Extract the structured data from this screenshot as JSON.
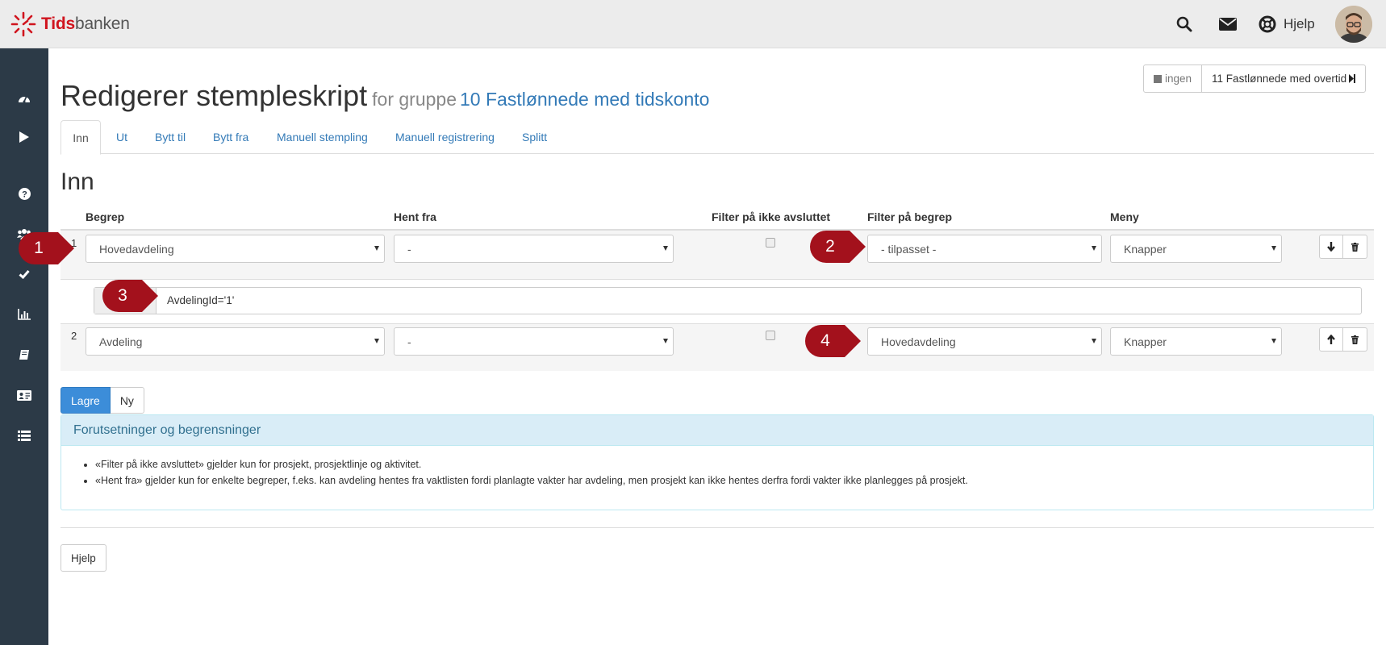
{
  "app": {
    "logo_bold": "Tids",
    "logo_rest": "banken",
    "help_label": "Hjelp"
  },
  "sidebar": {
    "icons": [
      "dashboard-icon",
      "play-icon",
      "question-icon",
      "users-icon",
      "check-icon",
      "bar-chart-icon",
      "book-icon",
      "id-card-icon",
      "list-icon"
    ]
  },
  "group_switch": {
    "prev_label": "ingen",
    "next_label": "11 Fastlønnede med overtid"
  },
  "page": {
    "title": "Redigerer stempleskript",
    "for_text": "for gruppe",
    "group_name": "10 Fastlønnede med tidskonto"
  },
  "tabs": [
    "Inn",
    "Ut",
    "Bytt til",
    "Bytt fra",
    "Manuell stempling",
    "Manuell registrering",
    "Splitt"
  ],
  "active_tab": "Inn",
  "section_title": "Inn",
  "table": {
    "headers": [
      "Begrep",
      "Hent fra",
      "Filter på ikke avsluttet",
      "Filter på begrep",
      "Meny"
    ],
    "rows": [
      {
        "num": "1",
        "begrep": "Hovedavdeling",
        "hent_fra": "-",
        "filter_ikke_avsluttet": false,
        "filter_begrep": "- tilpasset -",
        "meny": "Knapper"
      },
      {
        "num": "2",
        "begrep": "Avdeling",
        "hent_fra": "-",
        "filter_ikke_avsluttet": false,
        "filter_begrep": "Hovedavdeling",
        "meny": "Knapper"
      }
    ],
    "custom_filter_value": "AvdelingId='1'"
  },
  "buttons": {
    "save": "Lagre",
    "new": "Ny",
    "help": "Hjelp"
  },
  "panel": {
    "title": "Forutsetninger og begrensninger",
    "items": [
      "«Filter på ikke avsluttet» gjelder kun for prosjekt, prosjektlinje og aktivitet.",
      "«Hent fra» gjelder kun for enkelte begreper, f.eks. kan avdeling hentes fra vaktlisten fordi planlagte vakter har avdeling, men prosjekt kan ikke hentes derfra fordi vakter ikke planlegges på prosjekt."
    ]
  },
  "callouts": [
    "1",
    "2",
    "3",
    "4"
  ],
  "colors": {
    "brand_red": "#d0141e",
    "link_blue": "#337ab7",
    "sidebar_bg": "#2c3a47",
    "callout_red": "#a3111c",
    "primary_btn": "#3c8dd9",
    "info_bg": "#d9edf7"
  }
}
